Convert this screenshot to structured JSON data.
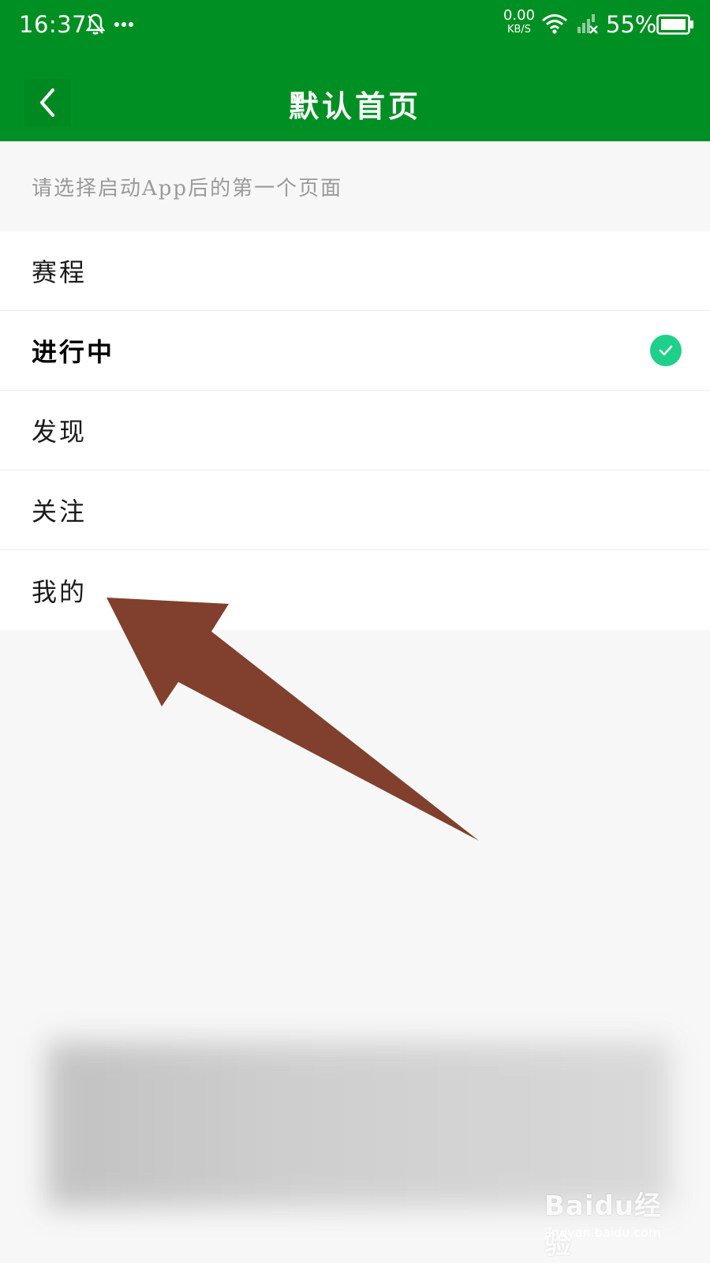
{
  "status_bar": {
    "time": "16:37",
    "net_speed_value": "0.00",
    "net_speed_unit": "KB/S",
    "battery": "55%",
    "icons": [
      "bell-off-icon",
      "more-dots-icon",
      "wifi-icon",
      "signal-icon",
      "battery-icon"
    ]
  },
  "header": {
    "title": "默认首页",
    "background": "#008f23",
    "back_icon": "chevron-left-icon"
  },
  "hint": "请选择启动App后的第一个页面",
  "options": [
    {
      "label": "赛程",
      "selected": false
    },
    {
      "label": "进行中",
      "selected": true
    },
    {
      "label": "发现",
      "selected": false
    },
    {
      "label": "关注",
      "selected": false
    },
    {
      "label": "我的",
      "selected": false
    }
  ],
  "check_color": "#1fd08a",
  "annotation_arrow_color": "#80402d",
  "watermark": {
    "main": "Baidu经验",
    "sub": "jingyan.baidu.com"
  }
}
